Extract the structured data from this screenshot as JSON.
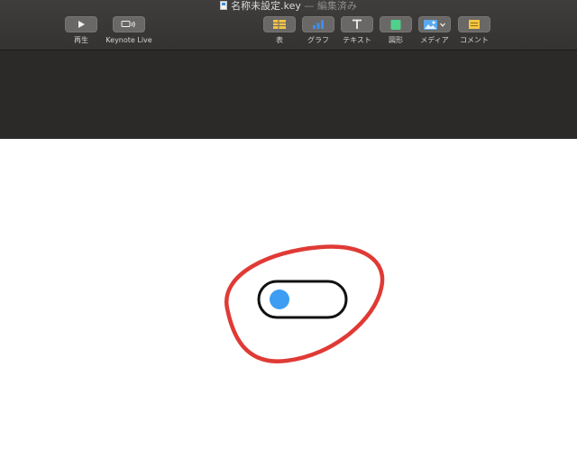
{
  "window": {
    "title": "名称未設定.key",
    "status": "— 編集済み"
  },
  "toolbar": {
    "left": [
      {
        "id": "play",
        "label": "再生",
        "icon": "play-icon"
      },
      {
        "id": "keynote-live",
        "label": "Keynote Live",
        "icon": "keynote-live-icon"
      }
    ],
    "right": [
      {
        "id": "table",
        "label": "表",
        "icon": "table-icon"
      },
      {
        "id": "chart",
        "label": "グラフ",
        "icon": "chart-icon"
      },
      {
        "id": "text",
        "label": "テキスト",
        "icon": "text-icon"
      },
      {
        "id": "shape",
        "label": "図形",
        "icon": "shape-icon"
      },
      {
        "id": "media",
        "label": "メディア",
        "icon": "media-icon"
      },
      {
        "id": "comment",
        "label": "コメント",
        "icon": "comment-icon"
      }
    ]
  },
  "slide": {
    "toggle": {
      "state": "off",
      "knob_color": "#3d9df2"
    },
    "annotation_color": "#e03a35"
  }
}
